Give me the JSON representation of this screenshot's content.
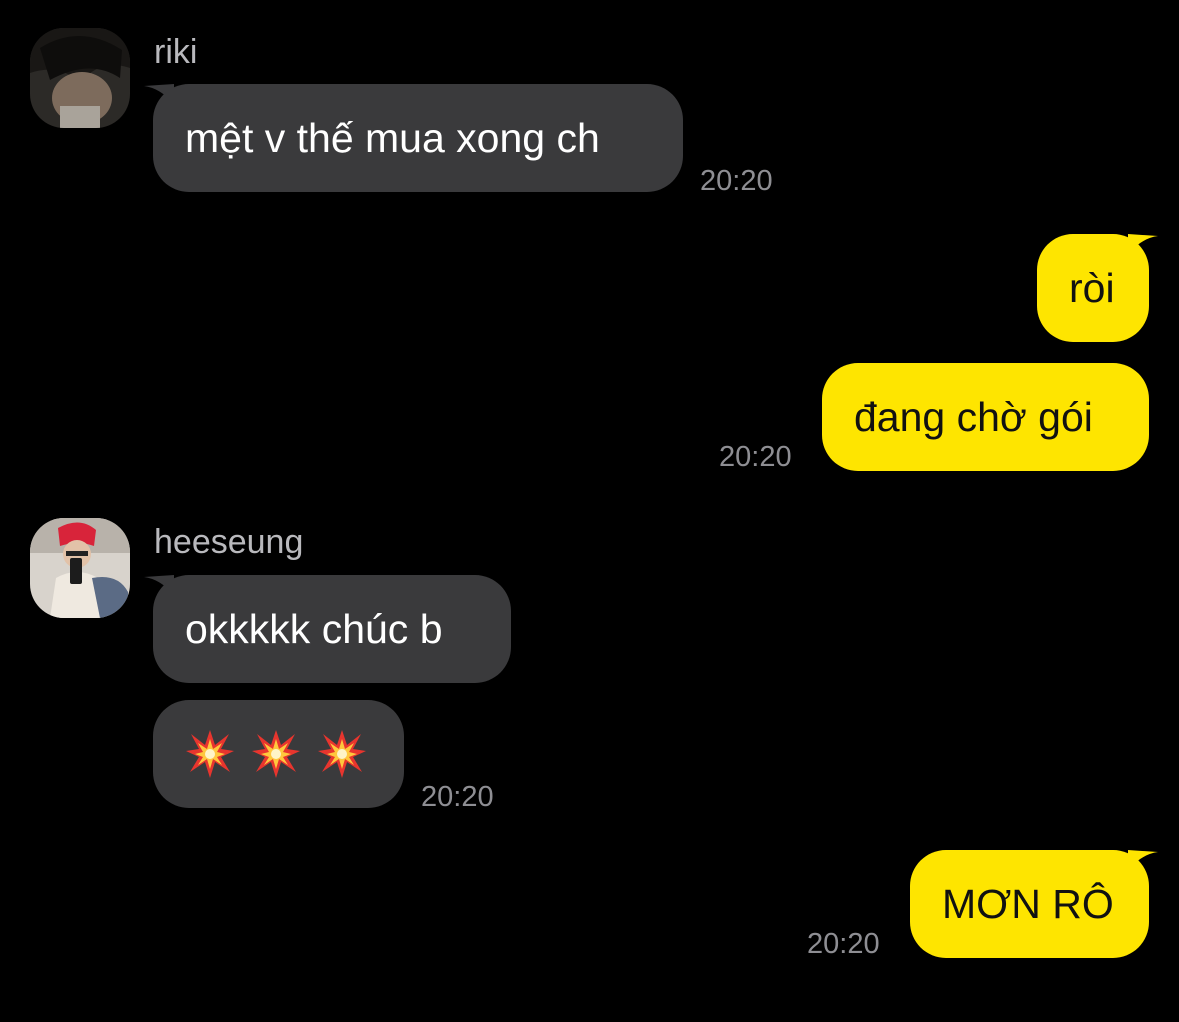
{
  "conversation": {
    "group1": {
      "sender": "riki",
      "message": "mệt v thế mua xong ch",
      "time": "20:20"
    },
    "group2": {
      "messages": [
        "ròi",
        "đang chờ gói"
      ],
      "time": "20:20"
    },
    "group3": {
      "sender": "heeseung",
      "message": "okkkkk chúc b",
      "reaction_icons": [
        "collision-icon",
        "collision-icon",
        "collision-icon"
      ],
      "time": "20:20"
    },
    "group4": {
      "message": "MƠN RÔ",
      "time": "20:20"
    }
  },
  "colors": {
    "background": "#000000",
    "incoming_bubble": "#3a3a3c",
    "outgoing_bubble": "#fee500"
  }
}
